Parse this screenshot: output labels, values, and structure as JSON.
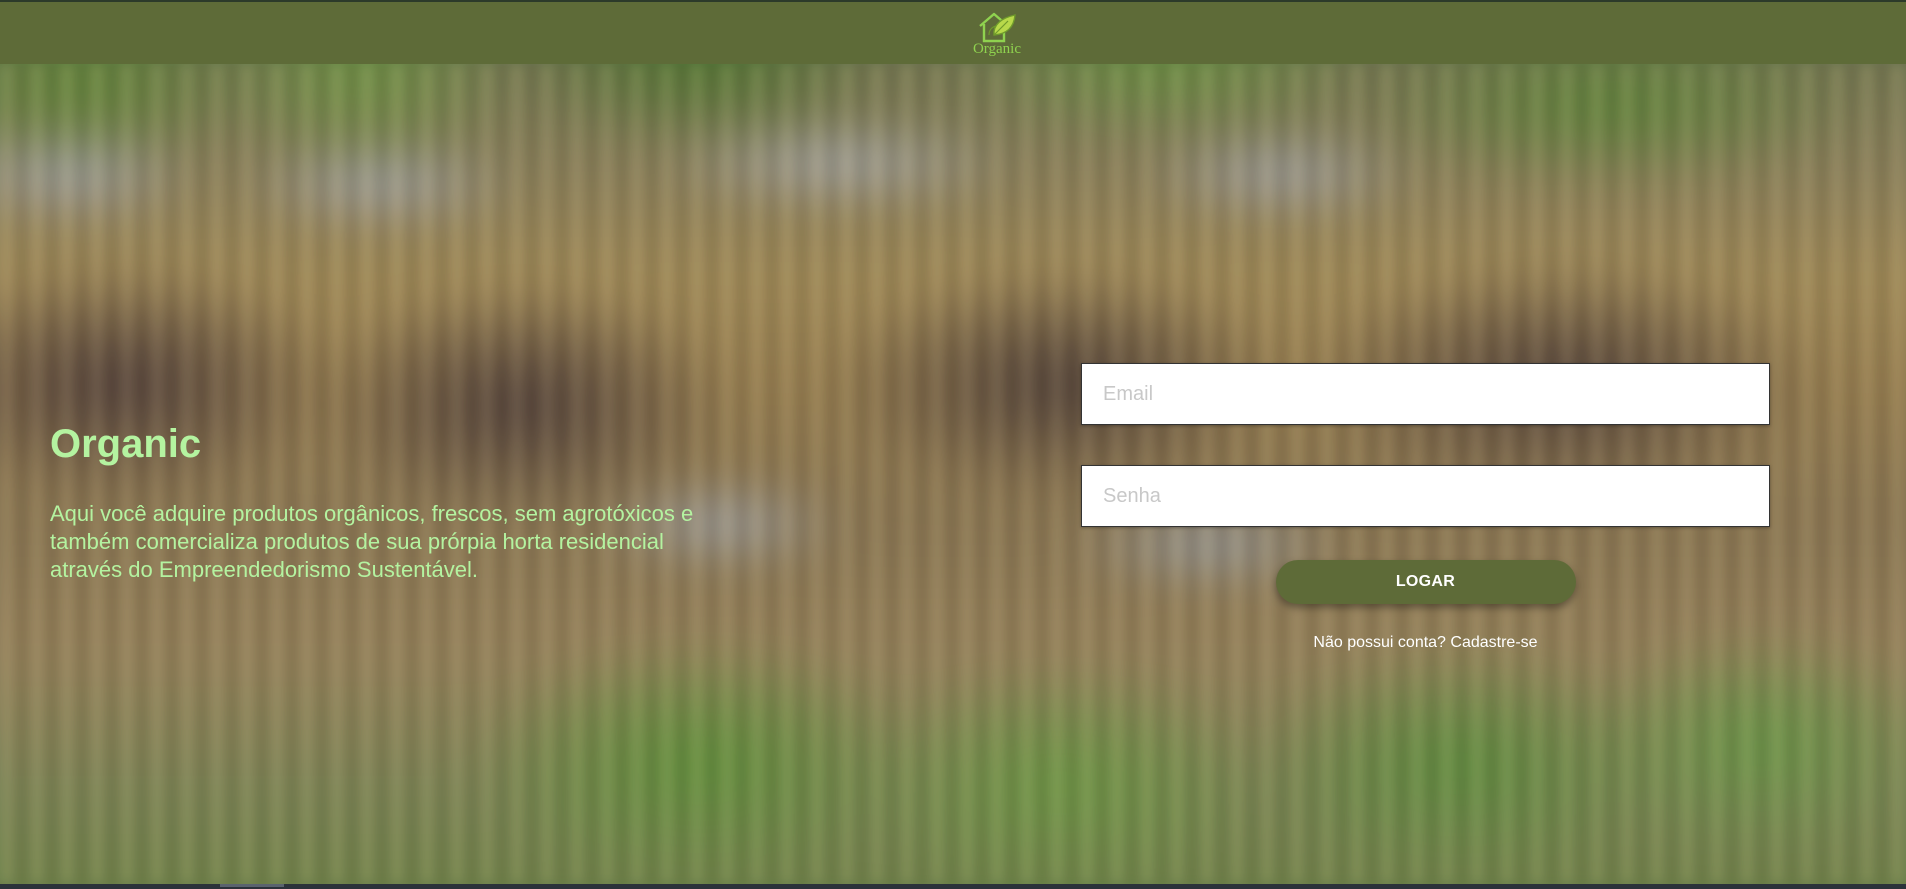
{
  "header": {
    "logo_text": "Organic",
    "logo_icon": "leaf-house-icon",
    "background_color": "#5e6b38",
    "logo_color": "#8fd24f"
  },
  "hero": {
    "title": "Organic",
    "description": "Aqui você adquire produtos orgânicos, frescos, sem agrotóxicos e também comercializa produtos de sua prórpia horta residencial através do Empreendedorismo Sustentável.",
    "text_color": "#b4f3a0"
  },
  "login_form": {
    "email_placeholder": "Email",
    "email_value": "",
    "password_placeholder": "Senha",
    "password_value": "",
    "submit_label": "LOGAR",
    "signup_prompt": "Não possui conta?",
    "signup_link": "Cadastre-se",
    "button_color": "#5e6b38"
  }
}
